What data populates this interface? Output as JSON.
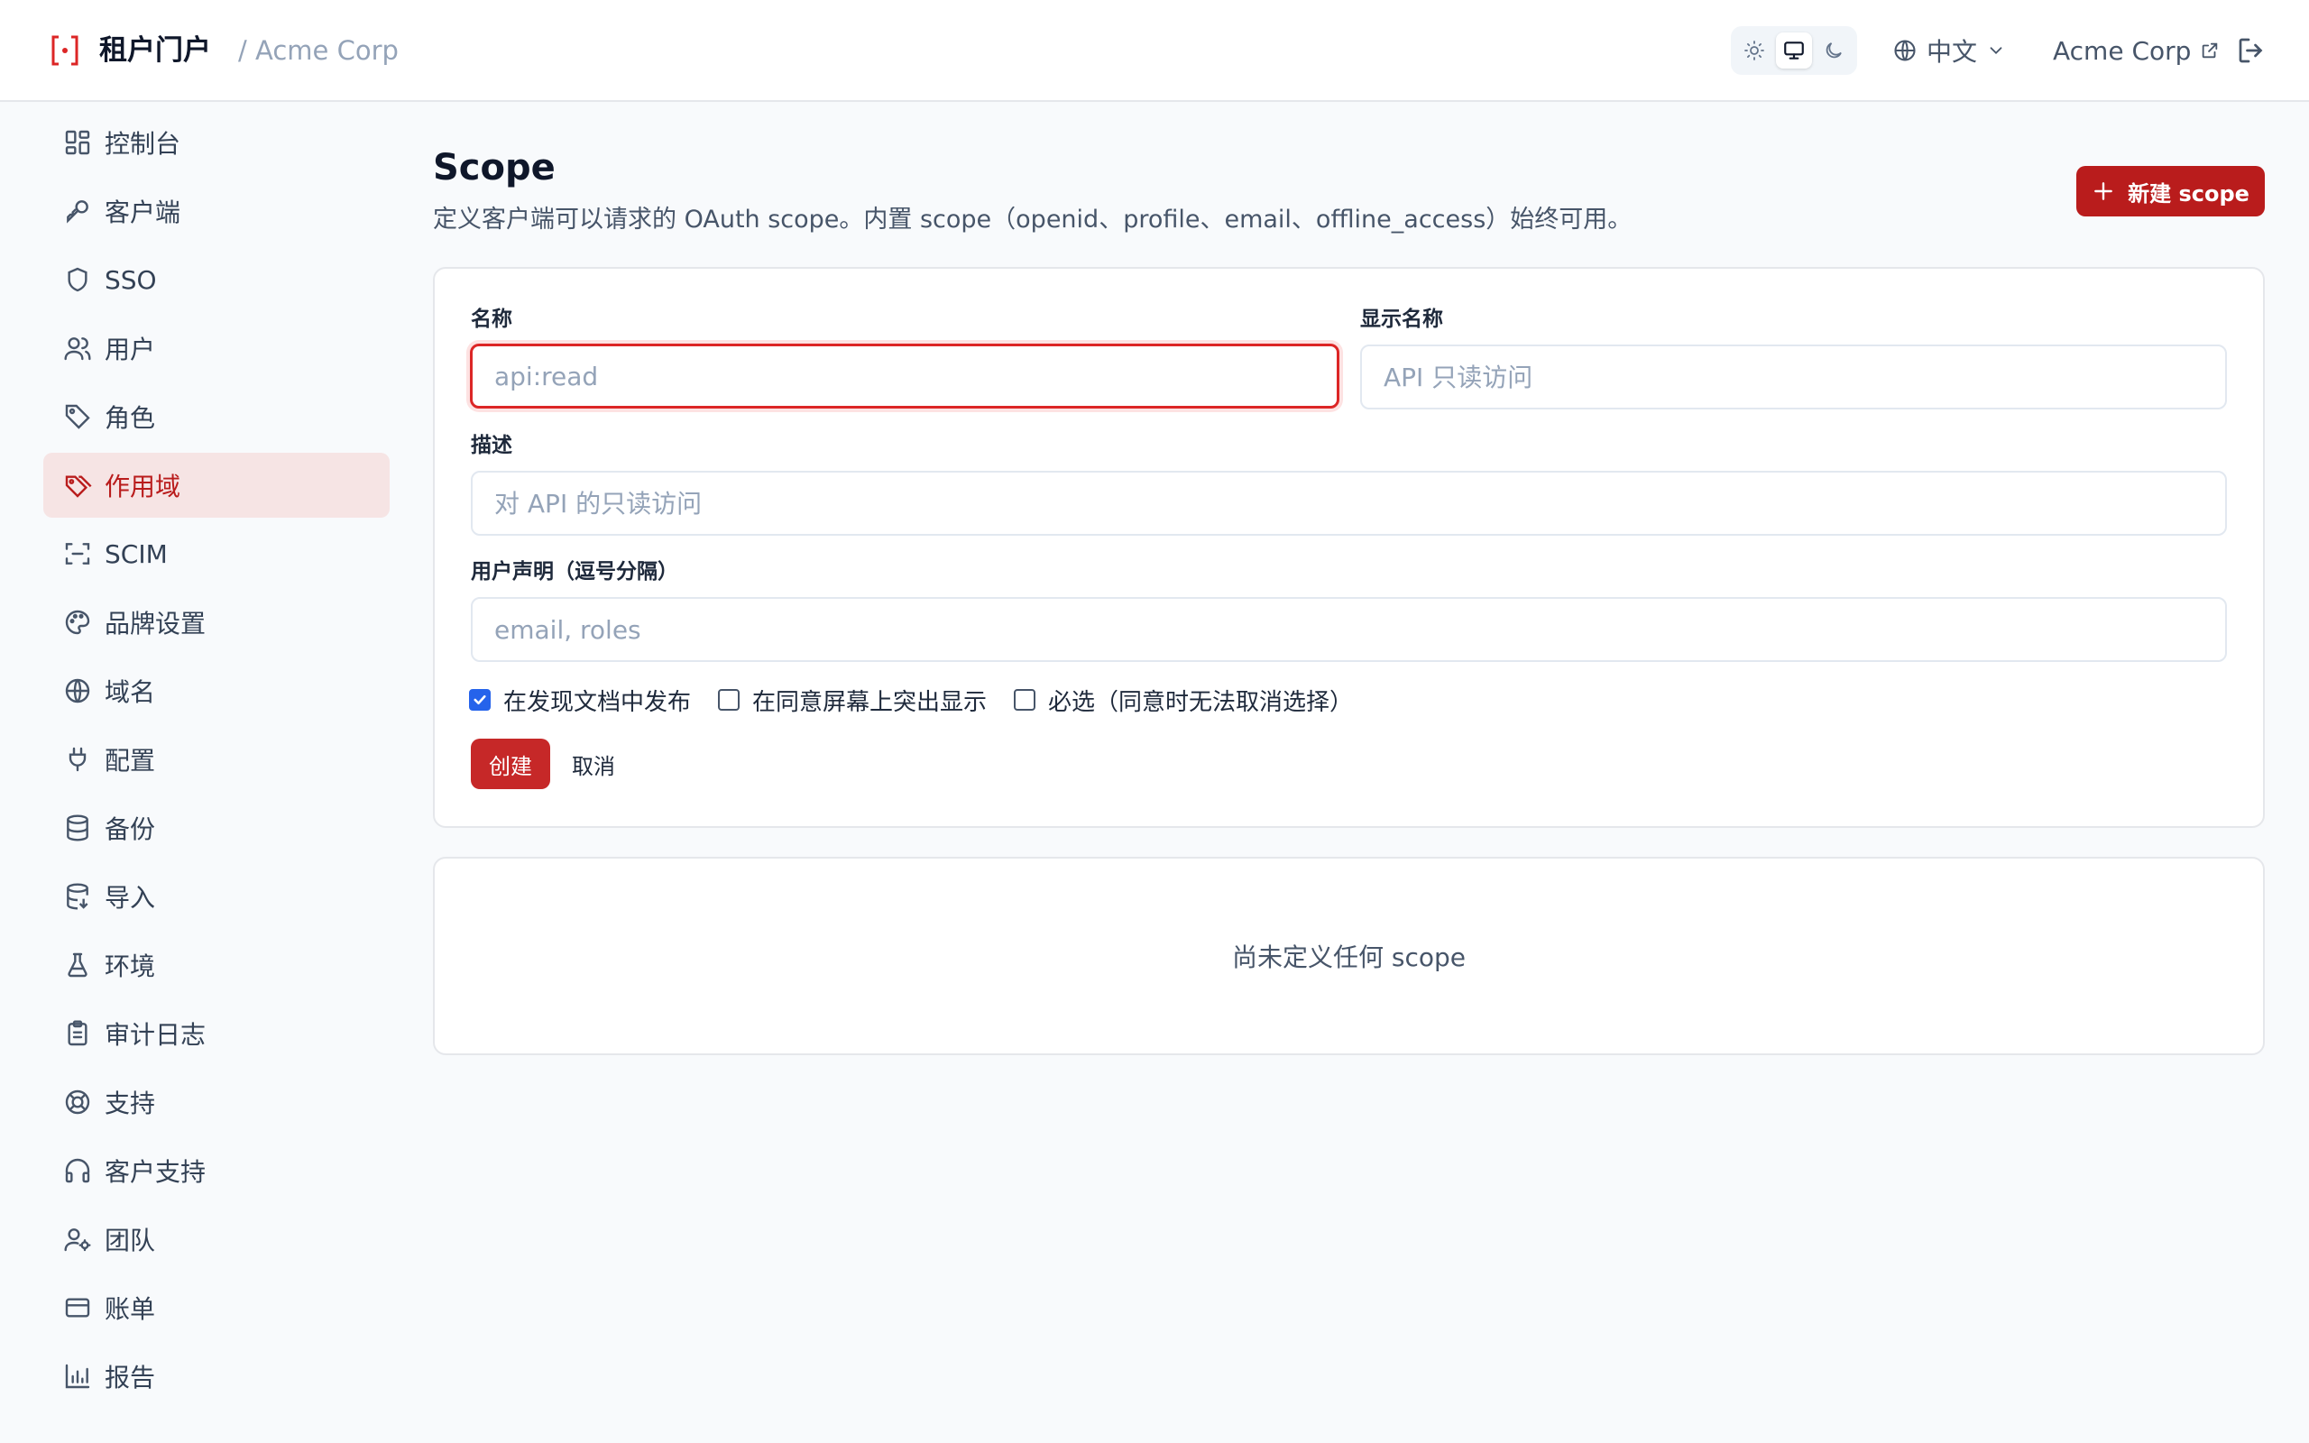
{
  "header": {
    "brand": "租户门户",
    "tenant": "/ Acme Corp",
    "theme_options": [
      "sun-icon",
      "monitor-icon",
      "moon-icon"
    ],
    "active_theme": "monitor",
    "language": "中文",
    "account": "Acme Corp"
  },
  "sidebar": {
    "items": [
      {
        "label": "控制台",
        "icon": "dashboard-icon"
      },
      {
        "label": "客户端",
        "icon": "key-icon"
      },
      {
        "label": "SSO",
        "icon": "shield-icon"
      },
      {
        "label": "用户",
        "icon": "users-icon"
      },
      {
        "label": "角色",
        "icon": "tag-icon"
      },
      {
        "label": "作用域",
        "icon": "tags-icon",
        "active": true
      },
      {
        "label": "SCIM",
        "icon": "scan-icon"
      },
      {
        "label": "品牌设置",
        "icon": "palette-icon"
      },
      {
        "label": "域名",
        "icon": "globe-icon"
      },
      {
        "label": "配置",
        "icon": "plug-icon"
      },
      {
        "label": "备份",
        "icon": "database-icon"
      },
      {
        "label": "导入",
        "icon": "database-import-icon"
      },
      {
        "label": "环境",
        "icon": "flask-icon"
      },
      {
        "label": "审计日志",
        "icon": "clipboard-icon"
      },
      {
        "label": "支持",
        "icon": "lifebuoy-icon"
      },
      {
        "label": "客户支持",
        "icon": "headphones-icon"
      },
      {
        "label": "团队",
        "icon": "user-cog-icon"
      },
      {
        "label": "账单",
        "icon": "credit-card-icon"
      },
      {
        "label": "报告",
        "icon": "bar-chart-icon"
      }
    ]
  },
  "main": {
    "title": "Scope",
    "description": "定义客户端可以请求的 OAuth scope。内置 scope（openid、profile、email、offline_access）始终可用。",
    "new_button": "新建 scope",
    "form": {
      "name_label": "名称",
      "name_placeholder": "api:read",
      "display_label": "显示名称",
      "display_placeholder": "API 只读访问",
      "desc_label": "描述",
      "desc_placeholder": "对 API 的只读访问",
      "claims_label": "用户声明（逗号分隔）",
      "claims_placeholder": "email, roles",
      "check_publish": "在发现文档中发布",
      "check_publish_checked": true,
      "check_consent": "在同意屏幕上突出显示",
      "check_consent_checked": false,
      "check_required": "必选（同意时无法取消选择）",
      "check_required_checked": false,
      "create": "创建",
      "cancel": "取消"
    },
    "empty_text": "尚未定义任何 scope"
  },
  "colors": {
    "accent": "#b91c1c",
    "active_bg": "#f6e4e4",
    "checkbox": "#2563eb"
  }
}
